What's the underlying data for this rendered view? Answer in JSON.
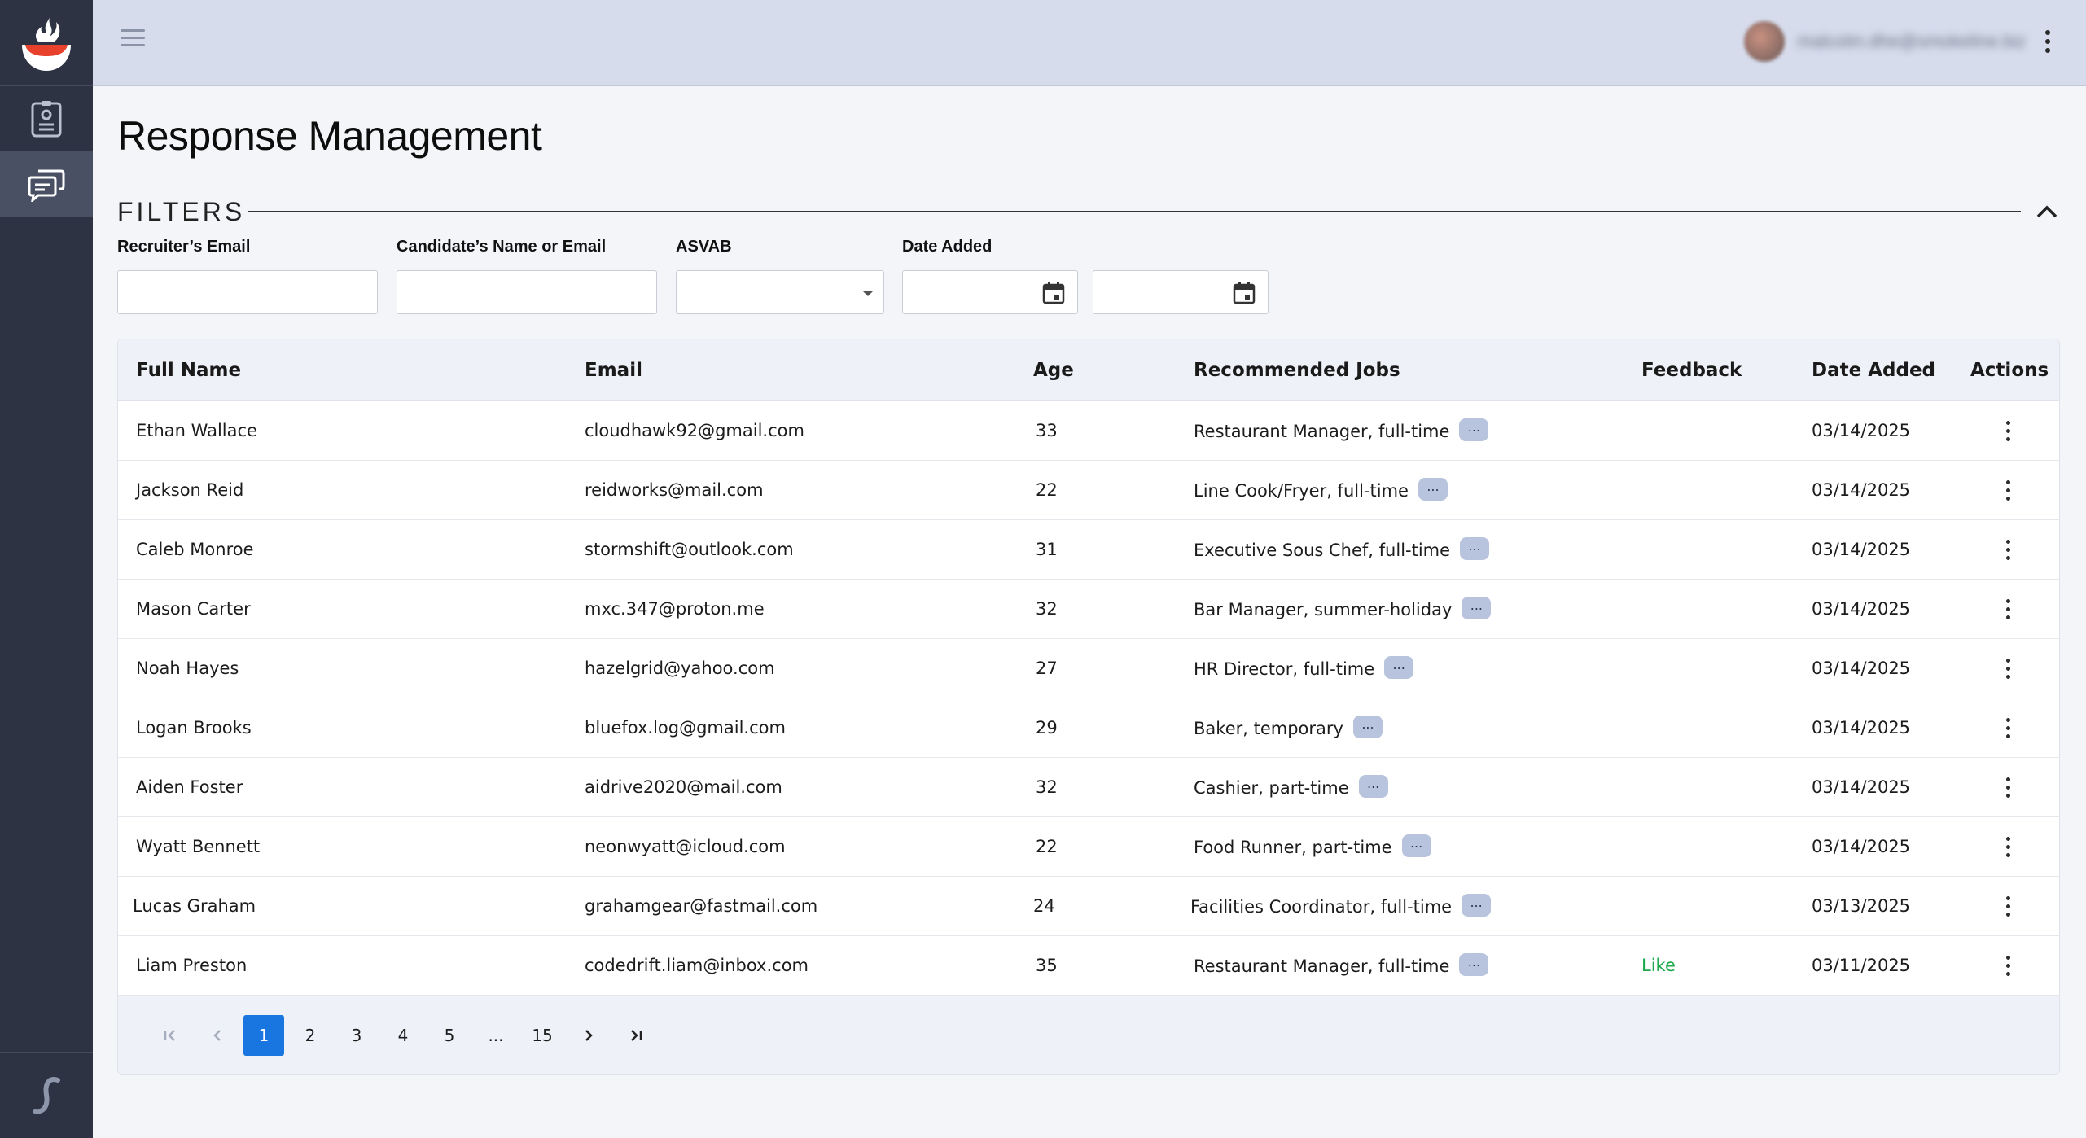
{
  "user": {
    "email": "malcolm.dhe@smokeline.biz"
  },
  "page": {
    "title": "Response Management"
  },
  "filters": {
    "title": "FILTERS",
    "recruiter_email_label": "Recruiter’s Email",
    "candidate_label": "Candidate’s Name or Email",
    "asvab_label": "ASVAB",
    "date_added_label": "Date Added"
  },
  "table": {
    "columns": [
      "Full Name",
      "Email",
      "Age",
      "Recommended Jobs",
      "Feedback",
      "Date Added",
      "Actions"
    ],
    "rows": [
      {
        "name": "Ethan Wallace",
        "email": "cloudhawk92@gmail.com",
        "age": "33",
        "jobs": "Restaurant Manager, full-time",
        "feedback": "",
        "date": "03/14/2025"
      },
      {
        "name": "Jackson Reid",
        "email": "reidworks@mail.com",
        "age": "22",
        "jobs": "Line Cook/Fryer, full-time",
        "feedback": "",
        "date": "03/14/2025"
      },
      {
        "name": "Caleb Monroe",
        "email": "stormshift@outlook.com",
        "age": "31",
        "jobs": "Executive Sous Chef, full-time",
        "feedback": "",
        "date": "03/14/2025"
      },
      {
        "name": "Mason Carter",
        "email": "mxc.347@proton.me",
        "age": "32",
        "jobs": "Bar Manager, summer-holiday",
        "feedback": "",
        "date": "03/14/2025"
      },
      {
        "name": "Noah Hayes",
        "email": "hazelgrid@yahoo.com",
        "age": "27",
        "jobs": "HR Director, full-time",
        "feedback": "",
        "date": "03/14/2025"
      },
      {
        "name": "Logan Brooks",
        "email": "bluefox.log@gmail.com",
        "age": "29",
        "jobs": "Baker, temporary",
        "feedback": "",
        "date": "03/14/2025"
      },
      {
        "name": "Aiden Foster",
        "email": "aidrive2020@mail.com",
        "age": "32",
        "jobs": "Cashier, part-time",
        "feedback": "",
        "date": "03/14/2025"
      },
      {
        "name": "Wyatt Bennett",
        "email": "neonwyatt@icloud.com",
        "age": "22",
        "jobs": "Food Runner, part-time",
        "feedback": "",
        "date": "03/14/2025"
      },
      {
        "name": "Lucas Graham",
        "email": "grahamgear@fastmail.com",
        "age": "24",
        "jobs": "Facilities Coordinator, full-time",
        "feedback": "",
        "date": "03/13/2025"
      },
      {
        "name": "Liam Preston",
        "email": "codedrift.liam@inbox.com",
        "age": "35",
        "jobs": "Restaurant Manager, full-time",
        "feedback": "Like",
        "date": "03/11/2025"
      }
    ],
    "more_label": "..."
  },
  "pagination": {
    "pages": [
      "1",
      "2",
      "3",
      "4",
      "5",
      "...",
      "15"
    ],
    "current": "1"
  },
  "colors": {
    "accent": "#1976e0",
    "sidebar": "#2e3344",
    "topbar": "#d6dcec",
    "like": "#1eaa4c",
    "logo_red": "#e8412c"
  }
}
